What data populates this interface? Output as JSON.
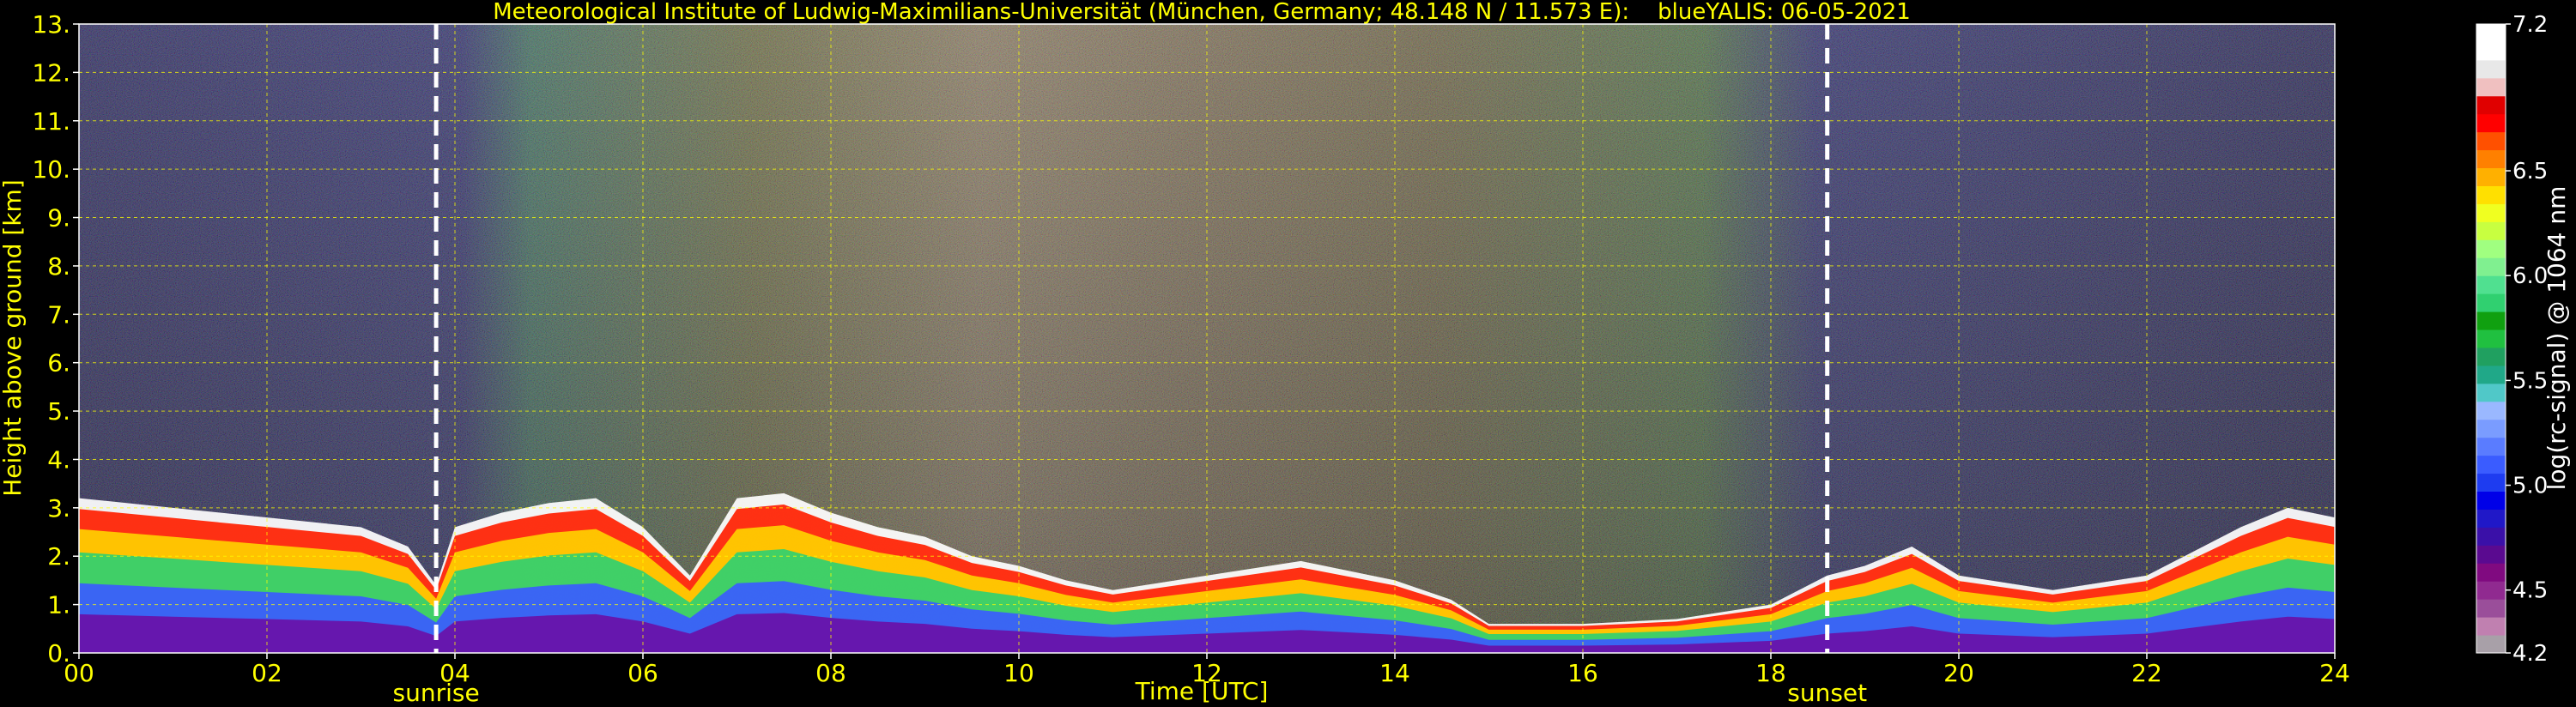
{
  "chart_data": {
    "type": "heatmap",
    "title": "Meteorological Institute of Ludwig-Maximilians-Universität (München, Germany; 48.148 N / 11.573 E):    blueYALIS: 06-05-2021",
    "xlabel": "Time [UTC]",
    "ylabel": "Height above ground [km]",
    "xlim": [
      0,
      24
    ],
    "ylim": [
      0,
      13
    ],
    "x_ticks": [
      "00",
      "02",
      "04",
      "06",
      "08",
      "10",
      "12",
      "14",
      "16",
      "18",
      "20",
      "22",
      "24"
    ],
    "y_ticks": [
      "0.",
      "1.",
      "2.",
      "3.",
      "4.",
      "5.",
      "6.",
      "7.",
      "8.",
      "9.",
      "10.",
      "11.",
      "12.",
      "13."
    ],
    "grid": true,
    "colorbar": {
      "label": "log(rc-signal) @ 1064 nm",
      "range": [
        4.2,
        7.2
      ],
      "ticks": [
        "4.2",
        "4.5",
        "5.0",
        "5.5",
        "6.0",
        "6.5",
        "7.2"
      ],
      "colors": [
        "#a8a0a8",
        "#c080b0",
        "#9a4e9a",
        "#902a90",
        "#800a80",
        "#5a0a90",
        "#3a10a8",
        "#2018c8",
        "#0000e8",
        "#1e3cf0",
        "#3a5cff",
        "#5a7cff",
        "#7a9cff",
        "#9ab8ff",
        "#50c8c8",
        "#20a888",
        "#20a060",
        "#20c040",
        "#10a010",
        "#30d070",
        "#50e090",
        "#80f090",
        "#a0ff80",
        "#c8ff40",
        "#f0ff20",
        "#ffe000",
        "#ffb000",
        "#ff8000",
        "#ff5000",
        "#ff0000",
        "#e00000",
        "#f0c0c0",
        "#e8e8e8",
        "#ffffff",
        "#ffffff"
      ]
    },
    "annotations": [
      {
        "x": 3.8,
        "text": "sunrise"
      },
      {
        "x": 18.6,
        "text": "sunset"
      }
    ],
    "boundary_layer_top_km": {
      "x": [
        0,
        1,
        2,
        3,
        3.5,
        3.8,
        4.0,
        4.5,
        5.0,
        5.5,
        6.0,
        6.5,
        7.0,
        7.5,
        8.0,
        8.5,
        9.0,
        9.5,
        10.0,
        10.5,
        11.0,
        12.0,
        13.0,
        14.0,
        14.6,
        15.0,
        16.0,
        17.0,
        18.0,
        18.6,
        19.0,
        19.5,
        20.0,
        21.0,
        22.0,
        23.0,
        23.5,
        24
      ],
      "y": [
        3.2,
        3.0,
        2.8,
        2.6,
        2.2,
        1.4,
        2.6,
        2.9,
        3.1,
        3.2,
        2.6,
        1.6,
        3.2,
        3.3,
        2.9,
        2.6,
        2.4,
        2.0,
        1.8,
        1.5,
        1.3,
        1.6,
        1.9,
        1.5,
        1.1,
        0.6,
        0.6,
        0.7,
        1.0,
        1.6,
        1.8,
        2.2,
        1.6,
        1.3,
        1.6,
        2.6,
        3.0,
        2.8
      ]
    }
  }
}
